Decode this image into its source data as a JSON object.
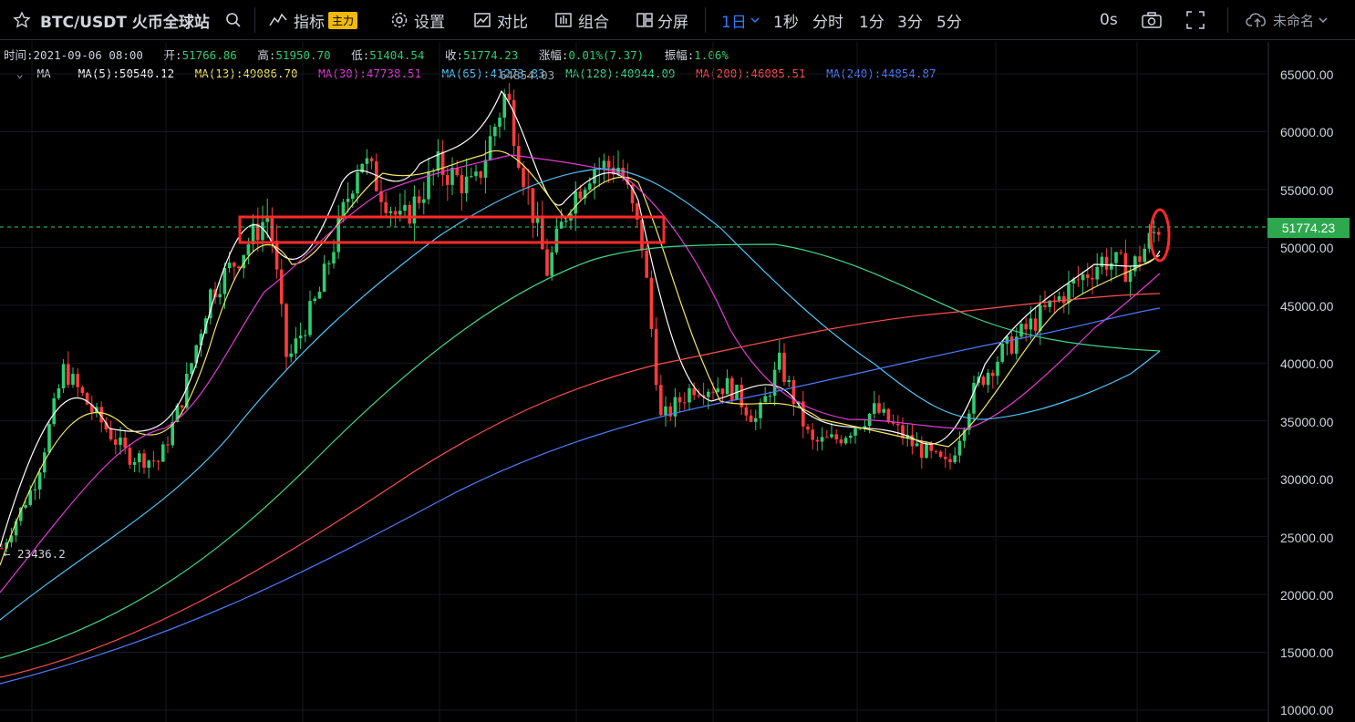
{
  "toolbar": {
    "symbol": "BTC/USDT 火币全球站",
    "indicators": "指标",
    "indicators_badge": "主力",
    "settings": "设置",
    "compare": "对比",
    "combine": "组合",
    "split": "分屏",
    "intervals": [
      "1日",
      "1秒",
      "分时",
      "1分",
      "3分",
      "5分"
    ],
    "active_interval": "1日",
    "countdown": "0s",
    "layout_name": "未命名"
  },
  "info": {
    "time_label": "时间:",
    "time": "2021-09-06 08:00",
    "open_label": "开:",
    "open": "51766.86",
    "high_label": "高:",
    "high": "51950.70",
    "low_label": "低:",
    "low": "51404.54",
    "close_label": "收:",
    "close": "51774.23",
    "change_label": "涨幅:",
    "change": "0.01%(7.37)",
    "amp_label": "振幅:",
    "amp": "1.06%"
  },
  "ma": {
    "label": "MA",
    "ma5": "MA(5):50540.12",
    "ma13": "MA(13):49086.70",
    "ma30": "MA(30):47738.51",
    "ma65": "MA(65):41273.83",
    "ma128": "MA(128):40944.09",
    "ma200": "MA(200):46085.51",
    "ma240": "MA(240):44854.87",
    "colors": {
      "ma5": "#ffffff",
      "ma13": "#f5e663",
      "ma30": "#e23ad6",
      "ma65": "#4fc3f7",
      "ma128": "#3dd68c",
      "ma200": "#ff4d4d",
      "ma240": "#4f7bff"
    }
  },
  "yaxis": [
    "65000.00",
    "60000.00",
    "55000.00",
    "50000.00",
    "45000.00",
    "40000.00",
    "35000.00",
    "30000.00",
    "25000.00",
    "20000.00",
    "15000.00",
    "10000.00"
  ],
  "last_price": "51774.23",
  "low_marker": "← 23436.2",
  "high_marker": "64854.03",
  "colors": {
    "up": "#2ecc71",
    "down": "#ff3b3b",
    "annotation": "#ff2a2a",
    "price_tag": "#2ea84f"
  }
}
